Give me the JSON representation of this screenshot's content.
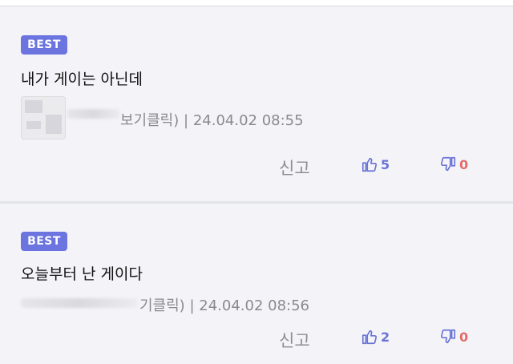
{
  "comments": [
    {
      "badge": "BEST",
      "text": "내가 게이는 아닌데",
      "author_suffix": "보기클릭)",
      "separator": "|",
      "timestamp": "24.04.02 08:55",
      "report_label": "신고",
      "likes": "5",
      "dislikes": "0"
    },
    {
      "badge": "BEST",
      "text": "오늘부터 난 게이다",
      "author_suffix": "기클릭)",
      "separator": "|",
      "timestamp": "24.04.02 08:56",
      "report_label": "신고",
      "likes": "2",
      "dislikes": "0"
    }
  ],
  "colors": {
    "badge": "#6b74df",
    "like": "#6a73d6",
    "dislike": "#e56b6b",
    "background": "#f4f4f8"
  },
  "icons": [
    "thumbs-up-icon",
    "thumbs-down-icon"
  ]
}
